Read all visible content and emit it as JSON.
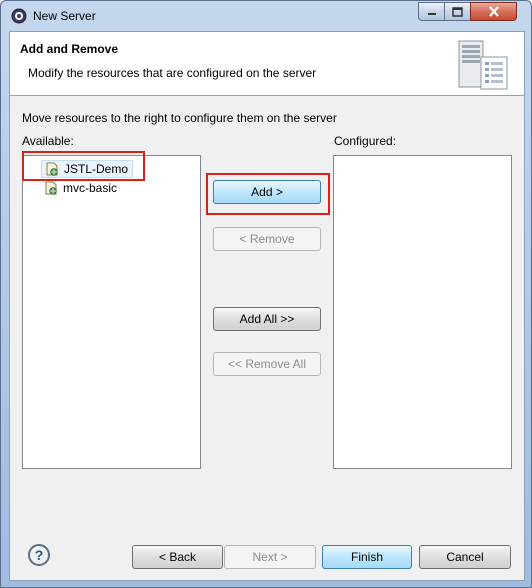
{
  "window": {
    "title": "New Server"
  },
  "header": {
    "title": "Add and Remove",
    "description": "Modify the resources that are configured on the server"
  },
  "instruction": "Move resources to the right to configure them on the server",
  "available": {
    "label": "Available:",
    "items": [
      {
        "label": "JSTL-Demo",
        "icon": "web-project-icon",
        "selected": true
      },
      {
        "label": "mvc-basic",
        "icon": "web-project-icon",
        "selected": false
      }
    ]
  },
  "configured": {
    "label": "Configured:",
    "items": []
  },
  "buttons": {
    "add": "Add >",
    "remove": "< Remove",
    "add_all": "Add All >>",
    "remove_all": "<< Remove All"
  },
  "footer": {
    "help": "?",
    "back": "< Back",
    "next": "Next >",
    "finish": "Finish",
    "cancel": "Cancel"
  },
  "colors": {
    "annotation": "#d9201f",
    "focus": "#3c7fb1"
  }
}
